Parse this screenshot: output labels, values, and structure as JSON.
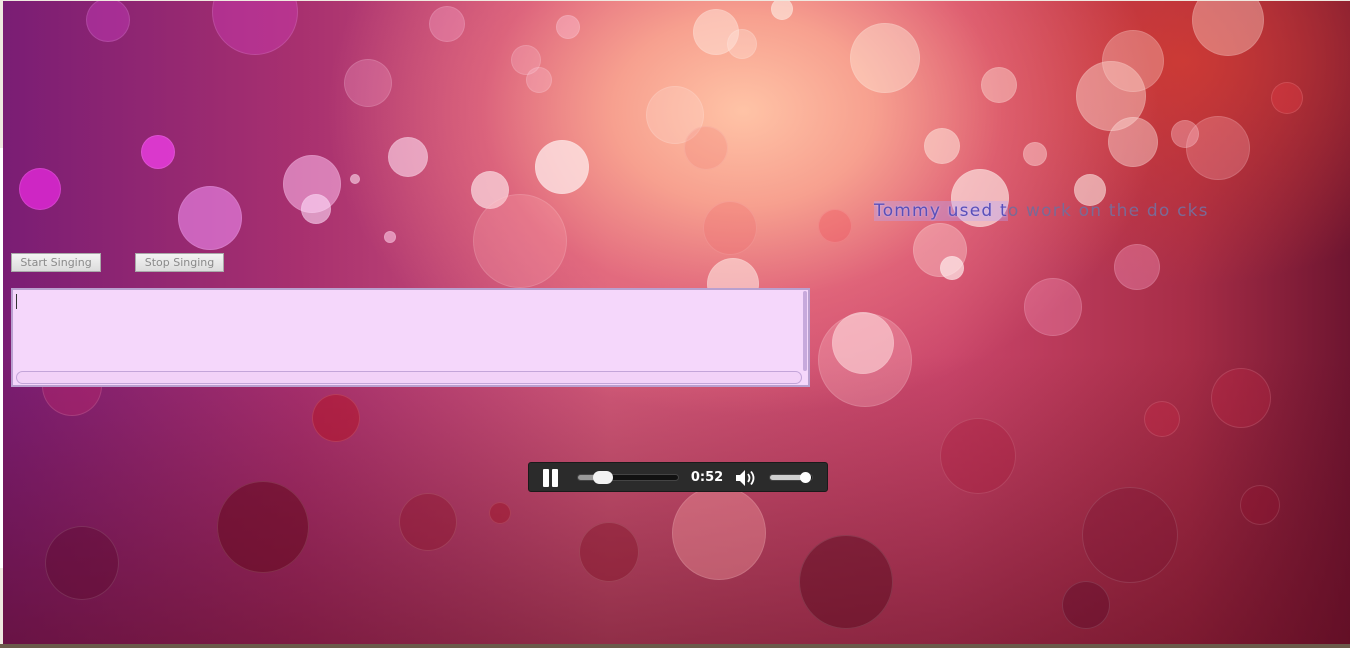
{
  "controls": {
    "start_label": "Start Singing",
    "stop_label": "Stop Singing"
  },
  "lyrics": {
    "sung": "Tommy used t",
    "unsung": "o work on the do  cks",
    "textbox_value": ""
  },
  "player": {
    "state": "playing",
    "current_time": "0:52",
    "progress_fraction": 0.25,
    "volume_fraction": 0.85,
    "pause_icon": "pause-icon",
    "volume_icon": "speaker-volume-icon"
  },
  "colors": {
    "textbox_bg": "#f5d7fb",
    "player_bg": "#2b2b2b",
    "sung_text": "#5a4fb8",
    "unsung_text": "#7a6a96"
  }
}
